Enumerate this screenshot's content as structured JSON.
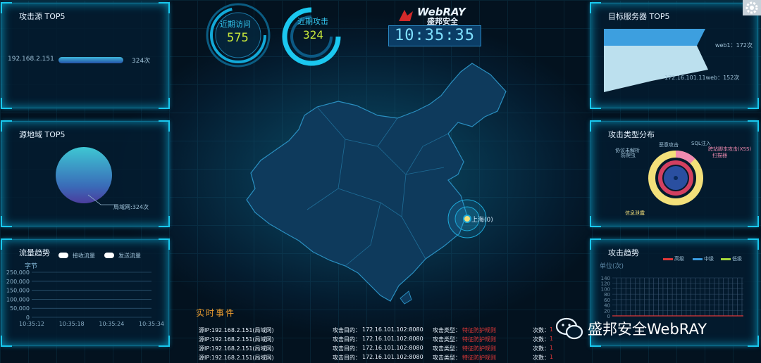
{
  "header": {
    "brand": "WebRAY",
    "brand_cn": "盛邦安全",
    "clock": "10:35:35",
    "gauge_visits": {
      "label": "近期访问",
      "value": "575"
    },
    "gauge_attacks": {
      "label": "近期攻击",
      "value": "324"
    }
  },
  "panels": {
    "attack_source": {
      "title": "攻击源 TOP5",
      "items": [
        {
          "ip": "192.168.2.151",
          "count_label": "324次",
          "fraction": 1.0
        }
      ]
    },
    "source_region": {
      "title": "源地域 TOP5",
      "pie_label": "局域网:324次"
    },
    "traffic_trend": {
      "title": "流量趋势",
      "unit": "字节",
      "legend": [
        "接收流量",
        "发送流量"
      ],
      "y_ticks": [
        "250,000",
        "200,000",
        "150,000",
        "100,000",
        "50,000",
        "0"
      ],
      "x_ticks": [
        "10:35:12",
        "10:35:18",
        "10:35:24",
        "10:35:34"
      ]
    },
    "target_server": {
      "title": "目标服务器 TOP5",
      "items": [
        {
          "label": "web1：172次",
          "value": 172
        },
        {
          "label": "172.16.101.11web：152次",
          "value": 152
        }
      ]
    },
    "attack_type": {
      "title": "攻击类型分布",
      "labels": [
        "恶意攻击",
        "SQL注入",
        "协议未解析",
        "跨站脚本攻击(XSS)",
        "防爬虫",
        "扫描器",
        "信息泄露"
      ]
    },
    "attack_trend": {
      "title": "攻击趋势",
      "unit": "单位(次)",
      "legend": [
        "高级",
        "中级",
        "低级"
      ],
      "y_ticks": [
        "140",
        "120",
        "100",
        "80",
        "60",
        "40",
        "20",
        "0"
      ]
    }
  },
  "map": {
    "marker_label": "上海(0)"
  },
  "events": {
    "title": "实时事件",
    "rows": [
      {
        "src": "源IP:192.168.2.151(局域网)",
        "dst_label": "攻击目的：",
        "dst": "172.16.101.102:8080",
        "type_label": "攻击类型：",
        "type": "特征防护规则",
        "count_label": "次数：",
        "count": "1"
      },
      {
        "src": "源IP:192.168.2.151(局域网)",
        "dst_label": "攻击目的：",
        "dst": "172.16.101.102:8080",
        "type_label": "攻击类型：",
        "type": "特征防护规则",
        "count_label": "次数：",
        "count": "1"
      },
      {
        "src": "源IP:192.168.2.151(局域网)",
        "dst_label": "攻击目的：",
        "dst": "172.16.101.102:8080",
        "type_label": "攻击类型：",
        "type": "特征防护规则",
        "count_label": "次数：",
        "count": "1"
      },
      {
        "src": "源IP:192.168.2.151(局域网)",
        "dst_label": "攻击目的：",
        "dst": "172.16.101.102:8080",
        "type_label": "攻击类型：",
        "type": "特征防护规则",
        "count_label": "次数：",
        "count": "1"
      }
    ]
  },
  "watermark": {
    "text": "盛邦安全WebRAY",
    "icon": "wechat-icon"
  },
  "settings": {
    "icon": "gear-icon"
  },
  "colors": {
    "accent": "#19c8ee",
    "gauge_value": "#c8e83a",
    "event_type": "#e03838",
    "events_title": "#f0a030"
  }
}
